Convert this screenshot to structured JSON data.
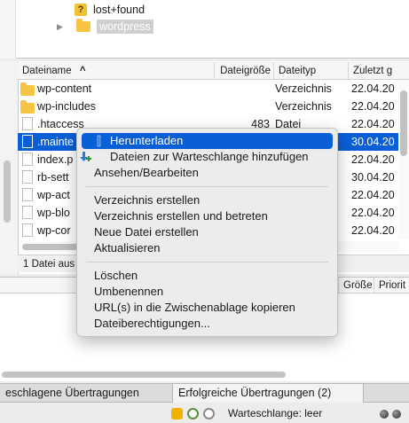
{
  "tree": {
    "items": [
      {
        "label": "lost+found",
        "icon": "question-folder-icon"
      },
      {
        "label": "wordpress",
        "icon": "folder-icon",
        "selected": true
      }
    ]
  },
  "filelist": {
    "columns": [
      "Dateiname",
      "Dateigröße",
      "Dateityp",
      "Zuletzt g"
    ],
    "sort_indicator": "^",
    "rows": [
      {
        "name": "wp-content",
        "size": "",
        "type": "Verzeichnis",
        "date": "22.04.20",
        "icon": "folder-icon"
      },
      {
        "name": "wp-includes",
        "size": "",
        "type": "Verzeichnis",
        "date": "22.04.20",
        "icon": "folder-icon"
      },
      {
        "name": ".htaccess",
        "size": "483",
        "type": "Datei",
        "date": "22.04.20",
        "icon": "file-icon"
      },
      {
        "name": ".mainte",
        "size": "",
        "type": "",
        "date": "30.04.20",
        "icon": "file-icon",
        "selected": true
      },
      {
        "name": "index.p",
        "size": "",
        "type": "",
        "date": "22.04.20",
        "icon": "file-icon"
      },
      {
        "name": "rb-sett",
        "size": "",
        "type": "",
        "date": "30.04.20",
        "icon": "file-icon"
      },
      {
        "name": "wp-act",
        "size": "",
        "type": "",
        "date": "22.04.20",
        "icon": "file-icon"
      },
      {
        "name": "wp-blo",
        "size": "",
        "type": "",
        "date": "22.04.20",
        "icon": "file-icon"
      },
      {
        "name": "wp-cor",
        "size": "",
        "type": "",
        "date": "22.04.20",
        "icon": "file-icon"
      }
    ],
    "status": "1 Datei aus"
  },
  "queue": {
    "columns": [
      "Größe",
      "Priorit"
    ]
  },
  "tabs": [
    {
      "label": "eschlagene Übertragungen"
    },
    {
      "label": "Erfolgreiche Übertragungen (2)"
    }
  ],
  "statusbar": {
    "queue_label": "Warteschlange: leer"
  },
  "context_menu": {
    "groups": [
      [
        {
          "label": "Herunterladen",
          "icon": "download-icon",
          "highlighted": true
        },
        {
          "label": "Dateien zur Warteschlange hinzufügen",
          "icon": "add-to-queue-icon"
        },
        {
          "label": "Ansehen/Bearbeiten"
        }
      ],
      [
        {
          "label": "Verzeichnis erstellen"
        },
        {
          "label": "Verzeichnis erstellen und betreten"
        },
        {
          "label": "Neue Datei erstellen"
        },
        {
          "label": "Aktualisieren"
        }
      ],
      [
        {
          "label": "Löschen"
        },
        {
          "label": "Umbenennen"
        },
        {
          "label": "URL(s) in die Zwischenablage kopieren"
        },
        {
          "label": "Dateiberechtigungen..."
        }
      ]
    ]
  },
  "colors": {
    "selection": "#0a5fd6",
    "folder": "#f6c343"
  }
}
